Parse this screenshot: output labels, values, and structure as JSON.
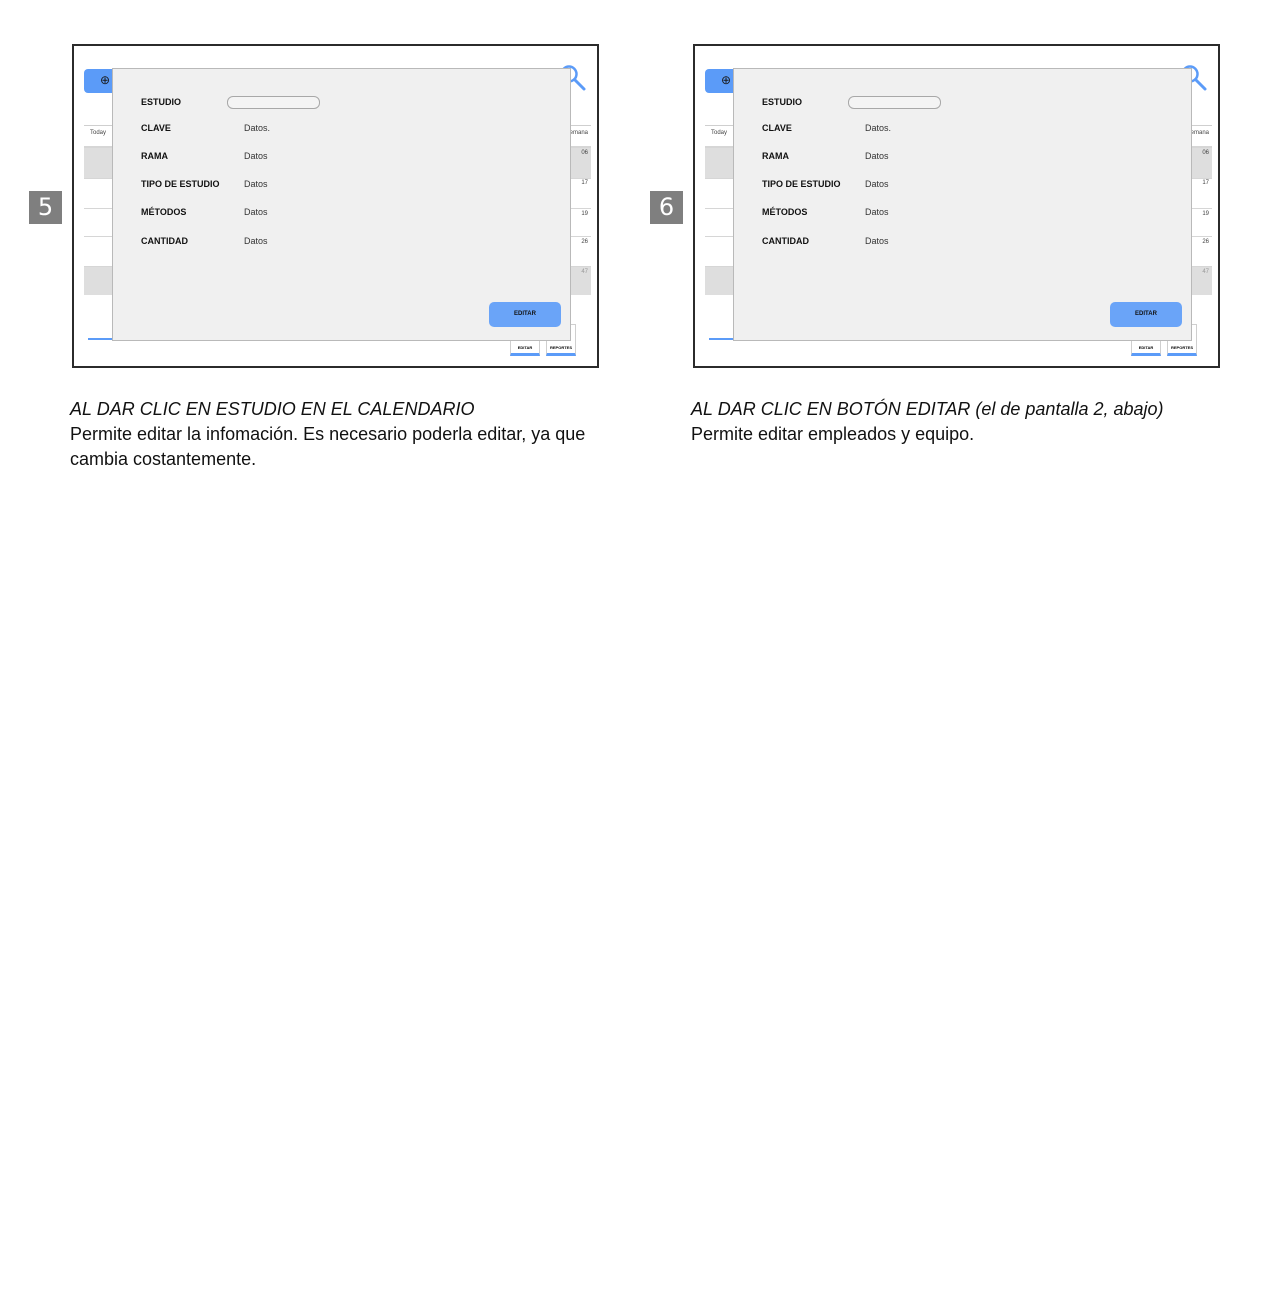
{
  "panels": [
    {
      "number": "5",
      "screen": {
        "calendar": {
          "today": "Today",
          "week": "Semana",
          "days": [
            "06",
            "17",
            "19",
            "26",
            "47"
          ]
        },
        "modal": {
          "fields": [
            {
              "label": "ESTUDIO",
              "value": ""
            },
            {
              "label": "CLAVE",
              "value": "Datos."
            },
            {
              "label": "RAMA",
              "value": "Datos"
            },
            {
              "label": "TIPO DE ESTUDIO",
              "value": "Datos"
            },
            {
              "label": "MÉTODOS",
              "value": "Datos"
            },
            {
              "label": "CANTIDAD",
              "value": "Datos"
            }
          ],
          "edit_label": "EDITAR"
        },
        "bottom_buttons": [
          "EDITAR",
          "REPORTES"
        ]
      },
      "caption_title": "AL DAR CLIC EN ESTUDIO EN EL CALENDARIO",
      "caption_body": "Permite editar la infomación. Es necesario poderla editar, ya que cambia costantemente."
    },
    {
      "number": "6",
      "screen": {
        "calendar": {
          "today": "Today",
          "week": "Semana",
          "days": [
            "06",
            "17",
            "19",
            "26",
            "47"
          ]
        },
        "modal": {
          "fields": [
            {
              "label": "ESTUDIO",
              "value": ""
            },
            {
              "label": "CLAVE",
              "value": "Datos."
            },
            {
              "label": "RAMA",
              "value": "Datos"
            },
            {
              "label": "TIPO DE ESTUDIO",
              "value": "Datos"
            },
            {
              "label": "MÉTODOS",
              "value": "Datos"
            },
            {
              "label": "CANTIDAD",
              "value": "Datos"
            }
          ],
          "edit_label": "EDITAR"
        },
        "bottom_buttons": [
          "EDITAR",
          "REPORTES"
        ]
      },
      "caption_title": "AL DAR CLIC EN BOTÓN EDITAR (el de pantalla 2, abajo)",
      "caption_body": "Permite editar empleados y equipo."
    }
  ],
  "colors": {
    "accent": "#5b9bf8",
    "modal_bg": "#f0f0f0",
    "badge": "#7f7f7f"
  }
}
